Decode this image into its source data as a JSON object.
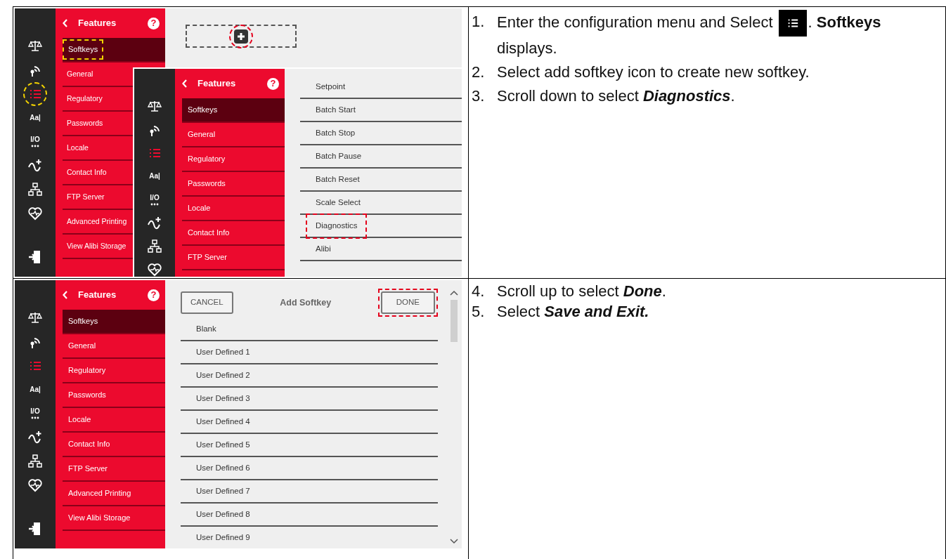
{
  "document": {
    "rows": [
      {
        "screens": [
          {
            "kind": "add_slot",
            "rail": [
              {
                "kind": "scale",
                "selected": false,
                "highlighted": false
              },
              {
                "kind": "signal",
                "selected": false,
                "highlighted": false
              },
              {
                "kind": "list",
                "selected": true,
                "highlighted": true
              },
              {
                "kind": "label",
                "label": "Aa|",
                "selected": false,
                "highlighted": false
              },
              {
                "kind": "io",
                "label": "I/O",
                "selected": false,
                "highlighted": false
              },
              {
                "kind": "wave",
                "selected": false,
                "highlighted": false
              },
              {
                "kind": "network",
                "selected": false,
                "highlighted": false
              },
              {
                "kind": "heart",
                "selected": false,
                "highlighted": false
              },
              {
                "kind": "exit",
                "selected": false,
                "highlighted": false
              }
            ],
            "menu": {
              "title": "Features",
              "help": "?",
              "items": [
                {
                  "label": "Softkeys",
                  "selected": true,
                  "highlighted": true
                },
                {
                  "label": "General",
                  "selected": false,
                  "highlighted": false
                },
                {
                  "label": "Regulatory",
                  "selected": false,
                  "highlighted": false
                },
                {
                  "label": "Passwords",
                  "selected": false,
                  "highlighted": false
                },
                {
                  "label": "Locale",
                  "selected": false,
                  "highlighted": false
                },
                {
                  "label": "Contact Info",
                  "selected": false,
                  "highlighted": false
                },
                {
                  "label": "FTP Server",
                  "selected": false,
                  "highlighted": false
                },
                {
                  "label": "Advanced Printing",
                  "selected": false,
                  "highlighted": false
                },
                {
                  "label": "View Alibi Storage",
                  "selected": false,
                  "highlighted": false
                }
              ]
            },
            "add_slot": {
              "highlighted": true
            }
          },
          {
            "kind": "softkey_list",
            "rail": [
              {
                "kind": "scale",
                "selected": false,
                "highlighted": false
              },
              {
                "kind": "signal",
                "selected": false,
                "highlighted": false
              },
              {
                "kind": "list",
                "selected": true,
                "highlighted": false
              },
              {
                "kind": "label",
                "label": "Aa|",
                "selected": false,
                "highlighted": false
              },
              {
                "kind": "io",
                "label": "I/O",
                "selected": false,
                "highlighted": false
              },
              {
                "kind": "wave",
                "selected": false,
                "highlighted": false
              },
              {
                "kind": "network",
                "selected": false,
                "highlighted": false
              },
              {
                "kind": "heart",
                "selected": false,
                "highlighted": false
              }
            ],
            "menu": {
              "title": "Features",
              "help": "?",
              "items": [
                {
                  "label": "Softkeys",
                  "selected": true,
                  "highlighted": false
                },
                {
                  "label": "General",
                  "selected": false,
                  "highlighted": false
                },
                {
                  "label": "Regulatory",
                  "selected": false,
                  "highlighted": false
                },
                {
                  "label": "Passwords",
                  "selected": false,
                  "highlighted": false
                },
                {
                  "label": "Locale",
                  "selected": false,
                  "highlighted": false
                },
                {
                  "label": "Contact Info",
                  "selected": false,
                  "highlighted": false
                },
                {
                  "label": "FTP Server",
                  "selected": false,
                  "highlighted": false
                }
              ]
            },
            "options": [
              {
                "label": "Setpoint",
                "highlighted": false
              },
              {
                "label": "Batch Start",
                "highlighted": false
              },
              {
                "label": "Batch Stop",
                "highlighted": false
              },
              {
                "label": "Batch Pause",
                "highlighted": false
              },
              {
                "label": "Batch Reset",
                "highlighted": false
              },
              {
                "label": "Scale Select",
                "highlighted": false
              },
              {
                "label": "Diagnostics",
                "highlighted": true
              },
              {
                "label": "Alibi",
                "highlighted": false
              }
            ]
          }
        ],
        "steps": [
          {
            "number": "1.",
            "text": "Enter the configuration menu and Select",
            "has_icon": true,
            "text_after": ". **Softkeys**",
            "continuation": "displays."
          },
          {
            "number": "2.",
            "text": "Select add softkey icon to create new softkey."
          },
          {
            "number": "3.",
            "text": "Scroll down to select ",
            "emphasis": "Diagnostics",
            "text_after": "."
          }
        ]
      },
      {
        "screens": [
          {
            "kind": "add_dialog",
            "rail": [
              {
                "kind": "scale",
                "selected": false,
                "highlighted": false
              },
              {
                "kind": "signal",
                "selected": false,
                "highlighted": false
              },
              {
                "kind": "list",
                "selected": true,
                "highlighted": false
              },
              {
                "kind": "label",
                "label": "Aa|",
                "selected": false,
                "highlighted": false
              },
              {
                "kind": "io",
                "label": "I/O",
                "selected": false,
                "highlighted": false
              },
              {
                "kind": "wave",
                "selected": false,
                "highlighted": false
              },
              {
                "kind": "network",
                "selected": false,
                "highlighted": false
              },
              {
                "kind": "heart",
                "selected": false,
                "highlighted": false
              },
              {
                "kind": "exit",
                "selected": false,
                "highlighted": false
              }
            ],
            "menu": {
              "title": "Features",
              "help": "?",
              "items": [
                {
                  "label": "Softkeys",
                  "selected": true,
                  "highlighted": false
                },
                {
                  "label": "General",
                  "selected": false,
                  "highlighted": false
                },
                {
                  "label": "Regulatory",
                  "selected": false,
                  "highlighted": false
                },
                {
                  "label": "Passwords",
                  "selected": false,
                  "highlighted": false
                },
                {
                  "label": "Locale",
                  "selected": false,
                  "highlighted": false
                },
                {
                  "label": "Contact Info",
                  "selected": false,
                  "highlighted": false
                },
                {
                  "label": "FTP Server",
                  "selected": false,
                  "highlighted": false
                },
                {
                  "label": "Advanced Printing",
                  "selected": false,
                  "highlighted": false
                },
                {
                  "label": "View Alibi Storage",
                  "selected": false,
                  "highlighted": false
                }
              ]
            },
            "dialog": {
              "cancel": "CANCEL",
              "title": "Add Softkey",
              "done": "DONE",
              "done_highlighted": true,
              "options": [
                {
                  "label": "Blank",
                  "highlighted": false
                },
                {
                  "label": "User Defined 1",
                  "highlighted": false
                },
                {
                  "label": "User Defined 2",
                  "highlighted": false
                },
                {
                  "label": "User Defined 3",
                  "highlighted": false
                },
                {
                  "label": "User Defined 4",
                  "highlighted": false
                },
                {
                  "label": "User Defined 5",
                  "highlighted": false
                },
                {
                  "label": "User Defined 6",
                  "highlighted": false
                },
                {
                  "label": "User Defined 7",
                  "highlighted": false
                },
                {
                  "label": "User Defined 8",
                  "highlighted": false
                },
                {
                  "label": "User Defined 9",
                  "highlighted": false
                }
              ]
            }
          }
        ],
        "steps": [
          {
            "number": "4.",
            "text": "Scroll up to select ",
            "emphasis": "Done",
            "text_after": "."
          },
          {
            "number": "5.",
            "text": "Select ",
            "emphasis": "Save and Exit."
          }
        ]
      }
    ]
  }
}
